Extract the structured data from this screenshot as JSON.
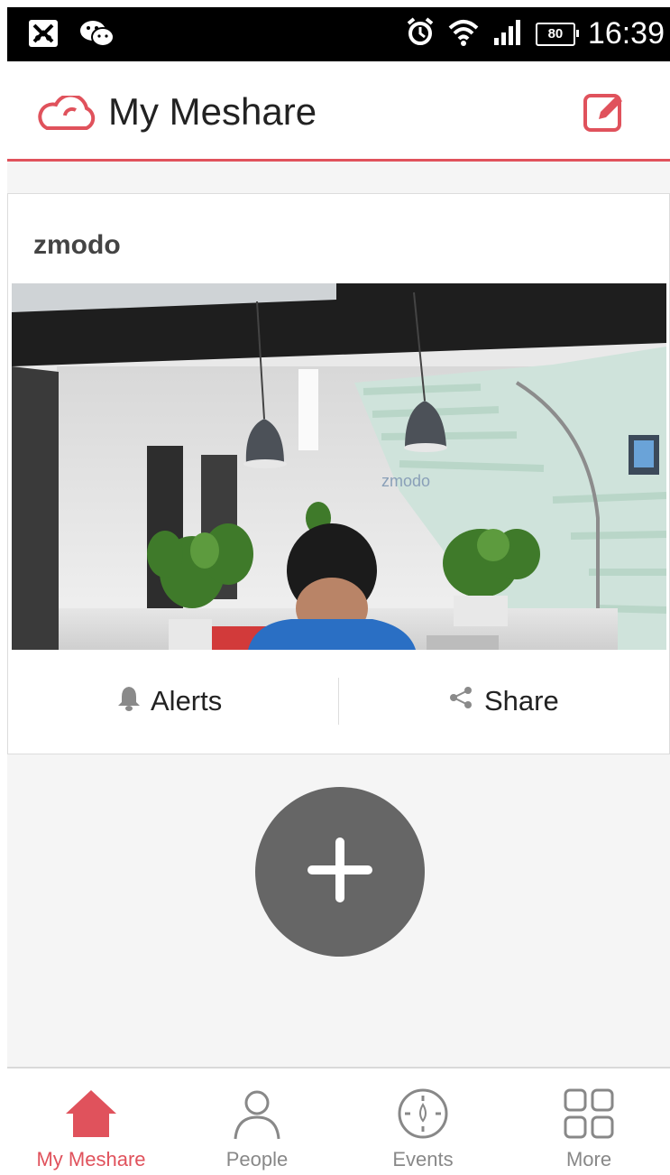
{
  "status_bar": {
    "time": "16:39",
    "battery": "80",
    "icons": [
      "app-notification-icon",
      "wechat-icon",
      "alarm-icon",
      "wifi-icon",
      "signal-icon",
      "battery-icon"
    ]
  },
  "header": {
    "title": "My Meshare",
    "logo_icon": "cloud-icon",
    "action_icon": "edit-icon"
  },
  "device_card": {
    "name": "zmodo",
    "actions": [
      {
        "label": "Alerts",
        "icon": "bell-icon"
      },
      {
        "label": "Share",
        "icon": "share-icon"
      }
    ]
  },
  "add_button": {
    "icon": "plus-icon"
  },
  "bottom_nav": {
    "items": [
      {
        "label": "My Meshare",
        "icon": "home-icon",
        "active": true
      },
      {
        "label": "People",
        "icon": "person-icon",
        "active": false
      },
      {
        "label": "Events",
        "icon": "events-icon",
        "active": false
      },
      {
        "label": "More",
        "icon": "grid-icon",
        "active": false
      }
    ]
  },
  "colors": {
    "accent": "#e0525c",
    "status_bar": "#000000",
    "fab": "#666666",
    "background": "#f5f5f5"
  }
}
